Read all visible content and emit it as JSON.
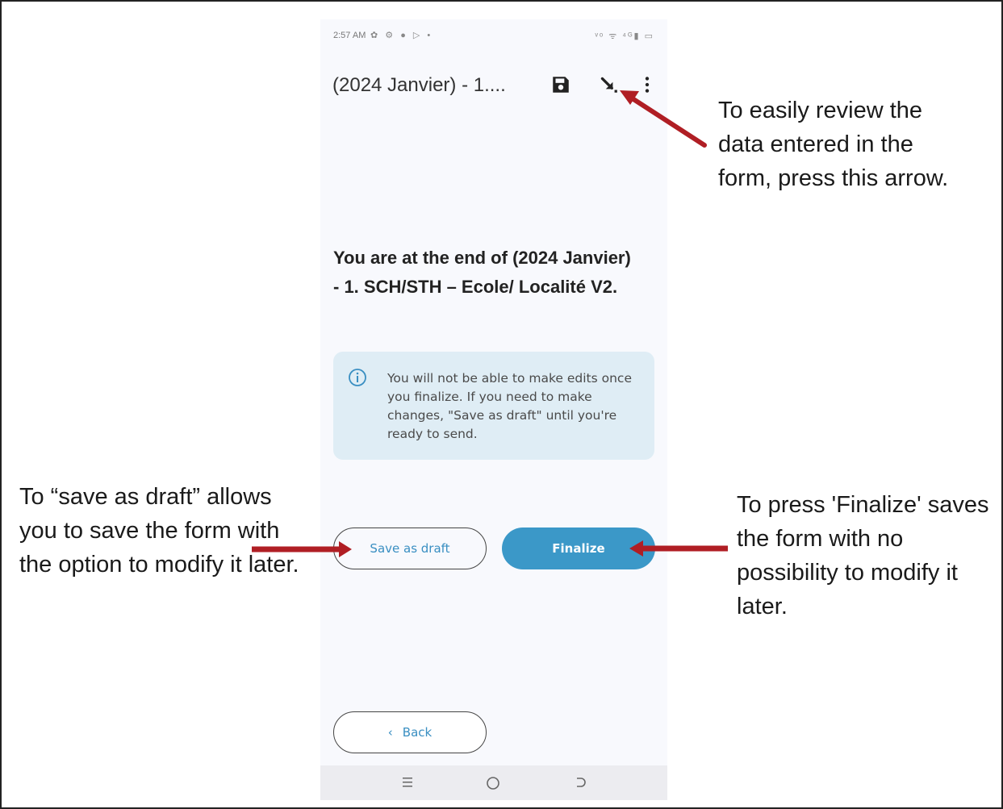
{
  "status_bar": {
    "time": "2:57 AM",
    "notification_icons": "✿ ⚙ ● ▷ •",
    "right_icons": "ᵛᵒ ᯤ ⁴ᴳ▮ ▭"
  },
  "toolbar": {
    "title": "(2024 Janvier) - 1....",
    "icons": [
      "save-icon",
      "jump-to-end-arrow-icon",
      "more-options-icon"
    ]
  },
  "content": {
    "end_heading": "You are at the end of (2024 Janvier) - 1. SCH/STH – Ecole/ Localité V2.",
    "info_message": "You will not be able to make edits once you finalize. If you need to make changes, \"Save as draft\" until you're ready to send."
  },
  "buttons": {
    "save_as_draft": "Save as draft",
    "finalize": "Finalize",
    "back": "Back"
  },
  "annotations": {
    "review_arrow": "To easily review the data entered in the form, press this arrow.",
    "save_draft": "To “save as draft” allows you to save the form with the option to modify it later.",
    "finalize": "To press 'Finalize' saves the form with no possibility to modify it later."
  },
  "colors": {
    "accent": "#3b98c8",
    "info_bg": "#dfedf5",
    "arrow": "#b01e24"
  }
}
